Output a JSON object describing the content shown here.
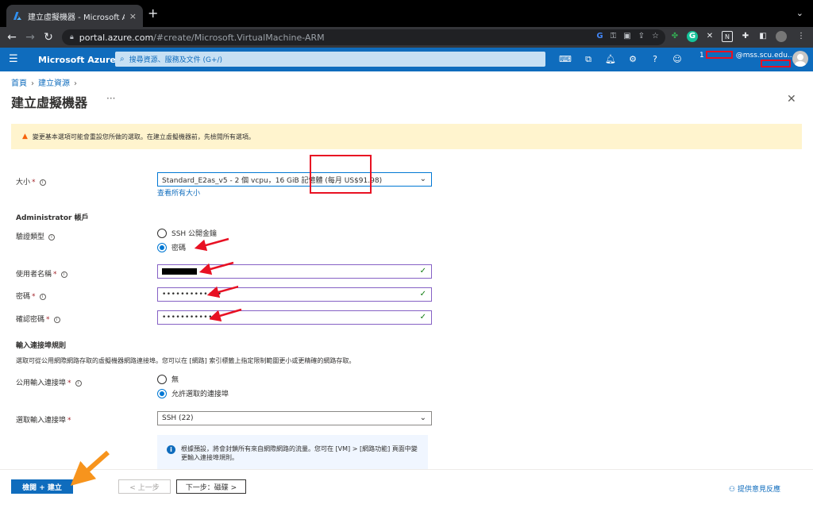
{
  "browser": {
    "tab_title": "建立虛擬機器 - Microsoft Azure",
    "tab_close": "×",
    "new_tab": "+",
    "url_host": "portal.azure.com",
    "url_path": "/#create/Microsoft.VirtualMachine-ARM"
  },
  "azure": {
    "brand": "Microsoft Azure",
    "search_placeholder": "搜尋資源、服務及文件 (G+/)",
    "account": "1              @mss.scu.edu..."
  },
  "breadcrumb": {
    "home": "首頁",
    "create": "建立資源"
  },
  "page": {
    "title": "建立虛擬機器",
    "more": "···",
    "warning": "變更基本選項可能會重設您所做的選取。在建立虛擬機器前，先檢閱所有選項。"
  },
  "form": {
    "size_label": "大小",
    "size_value": "Standard_E2as_v5 - 2 個 vcpu，16 GiB 記憶體 (每月 US$91.98)",
    "size_link": "查看所有大小",
    "admin_section": "Administrator 帳戶",
    "auth_label": "驗證類型",
    "auth_options": [
      "SSH 公開金鑰",
      "密碼"
    ],
    "auth_selected": "密碼",
    "username_label": "使用者名稱",
    "password_label": "密碼",
    "password_value": "•••••••••••••",
    "confirm_label": "確認密碼",
    "confirm_value": "•••••••••••••",
    "inbound_section": "輸入連接埠規則",
    "inbound_desc": "選取可從公用網際網路存取的虛擬機器網路連接埠。您可以在 [網路] 索引標籤上指定限制範圍更小或更精確的網路存取。",
    "public_ports_label": "公用輸入連接埠",
    "public_ports_options": [
      "無",
      "允許選取的連接埠"
    ],
    "public_ports_selected": "允許選取的連接埠",
    "select_ports_label": "選取輸入連接埠",
    "select_ports_value": "SSH (22)",
    "info_text": "根據預設，將會封鎖所有來自網際網路的流量。您可在 [VM] > [網路功能] 頁面中變更輸入連接埠規則。"
  },
  "footer": {
    "review_create": "檢閱 + 建立",
    "previous": "< 上一步",
    "next": "下一步：磁碟 >",
    "feedback": "提供意見反應"
  },
  "colors": {
    "azure_blue": "#0f6cbd",
    "warning_bg": "#fff4ce",
    "annotation_red": "#e81123",
    "annotation_orange": "#f7941d"
  }
}
